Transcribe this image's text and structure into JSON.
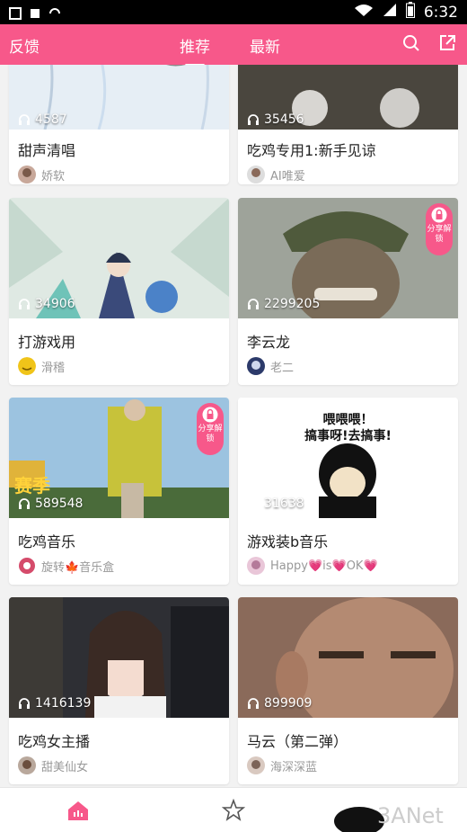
{
  "status_bar": {
    "time": "6:32"
  },
  "nav": {
    "left_label": "反馈",
    "tabs": [
      {
        "label": "推荐",
        "active": true
      },
      {
        "label": "最新",
        "active": false
      }
    ]
  },
  "cards": [
    {
      "title": "甜声清唱",
      "author": "娇软",
      "plays": "4587",
      "locked": false
    },
    {
      "title": "吃鸡专用1:新手见谅",
      "author": "AI唯爱",
      "plays": "35456",
      "locked": false
    },
    {
      "title": "打游戏用",
      "author": "滑稽",
      "plays": "34906",
      "locked": false
    },
    {
      "title": "李云龙",
      "author": "老二",
      "plays": "2299205",
      "locked": true,
      "lock_text": "分享解锁"
    },
    {
      "title": "吃鸡音乐",
      "author": "旋转🍁音乐盒",
      "plays": "589548",
      "locked": true,
      "lock_text": "分享解锁"
    },
    {
      "title": "游戏装b音乐",
      "author": "Happy💗is💗OK💗",
      "plays": "31638",
      "locked": false,
      "thumb_caption_1": "喂喂喂！",
      "thumb_caption_2": "搞事呀!去搞事!"
    },
    {
      "title": "吃鸡女主播",
      "author": "甜美仙女",
      "plays": "1416139",
      "locked": false
    },
    {
      "title": "马云（第二弹）",
      "author": "海深深蓝",
      "plays": "899909",
      "locked": false
    }
  ],
  "thumb_overlay_1": "赛季",
  "watermark_text": "3ANet",
  "colors": {
    "accent": "#f7588a"
  }
}
